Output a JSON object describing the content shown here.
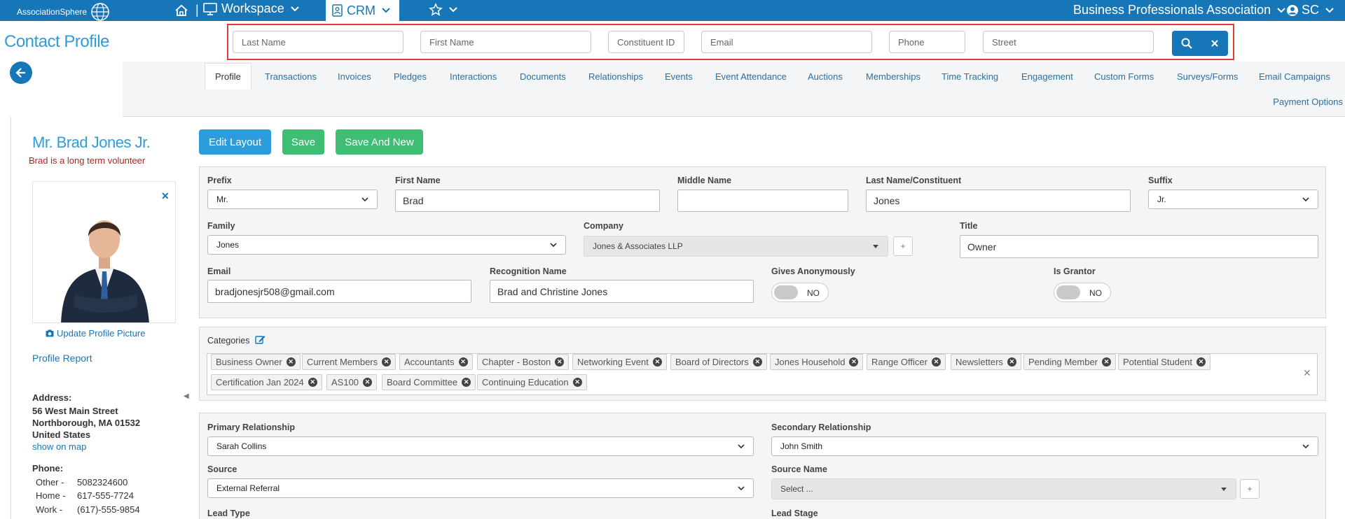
{
  "app": {
    "logo_text": "AssociationSphere",
    "workspace_label": "Workspace",
    "crm_label": "CRM",
    "org_name": "Business Professionals Association",
    "user_initials": "SC"
  },
  "page": {
    "title": "Contact Profile"
  },
  "search": {
    "last_name_placeholder": "Last Name",
    "first_name_placeholder": "First Name",
    "constituent_id_placeholder": "Constituent ID",
    "email_placeholder": "Email",
    "phone_placeholder": "Phone",
    "street_placeholder": "Street"
  },
  "tabs": [
    {
      "label": "Profile"
    },
    {
      "label": "Transactions"
    },
    {
      "label": "Invoices"
    },
    {
      "label": "Pledges"
    },
    {
      "label": "Interactions"
    },
    {
      "label": "Documents"
    },
    {
      "label": "Relationships"
    },
    {
      "label": "Events"
    },
    {
      "label": "Event Attendance"
    },
    {
      "label": "Auctions"
    },
    {
      "label": "Memberships"
    },
    {
      "label": "Time Tracking"
    },
    {
      "label": "Engagement"
    },
    {
      "label": "Custom Forms"
    },
    {
      "label": "Surveys/Forms"
    },
    {
      "label": "Email Campaigns"
    },
    {
      "label": "Payment Options"
    }
  ],
  "contact": {
    "display_name": "Mr. Brad Jones Jr.",
    "note": "Brad is a long term volunteer",
    "update_picture_label": "Update Profile Picture",
    "profile_report_label": "Profile Report",
    "address_label": "Address:",
    "address_line1": "56 West Main Street",
    "address_line2": "Northborough, MA 01532",
    "address_line3": "United States",
    "show_on_map": "show on map",
    "phone_label": "Phone:",
    "phones": [
      {
        "type": "Other -",
        "number": "5082324600"
      },
      {
        "type": "Home -",
        "number": "617-555-7724"
      },
      {
        "type": "Work -",
        "number": "(617)-555-9854"
      }
    ]
  },
  "actions": {
    "edit_layout": "Edit Layout",
    "save": "Save",
    "save_and_new": "Save And New"
  },
  "form": {
    "prefix_label": "Prefix",
    "prefix_value": "Mr.",
    "first_name_label": "First Name",
    "first_name_value": "Brad",
    "middle_name_label": "Middle Name",
    "middle_name_value": "",
    "last_name_label": "Last Name/Constituent",
    "last_name_value": "Jones",
    "suffix_label": "Suffix",
    "suffix_value": "Jr.",
    "family_label": "Family",
    "family_value": "Jones",
    "company_label": "Company",
    "company_value": "Jones & Associates LLP",
    "title_label": "Title",
    "title_value": "Owner",
    "email_label": "Email",
    "email_value": "bradjonesjr508@gmail.com",
    "recognition_label": "Recognition Name",
    "recognition_value": "Brad and Christine Jones",
    "gives_anon_label": "Gives Anonymously",
    "gives_anon_value": "NO",
    "is_grantor_label": "Is Grantor",
    "is_grantor_value": "NO"
  },
  "categories": {
    "label": "Categories",
    "tags": [
      "Business Owner",
      "Current Members",
      "Accountants",
      "Chapter - Boston",
      "Networking Event",
      "Board of Directors",
      "Jones Household",
      "Range Officer",
      "Newsletters",
      "Pending Member",
      "Potential Student",
      "Certification Jan 2024",
      "AS100",
      "Board Committee",
      "Continuing Education"
    ]
  },
  "relationships": {
    "primary_label": "Primary Relationship",
    "primary_value": "Sarah Collins",
    "secondary_label": "Secondary Relationship",
    "secondary_value": "John Smith",
    "source_label": "Source",
    "source_value": "External Referral",
    "source_name_label": "Source Name",
    "source_name_value": "Select ...",
    "lead_type_label": "Lead Type",
    "lead_stage_label": "Lead Stage"
  },
  "colors": {
    "brand_blue": "#1776b8",
    "accent_blue": "#2d9cdb",
    "green": "#3ebd73",
    "note_red": "#b42323",
    "highlight_red": "#e03a3a"
  }
}
